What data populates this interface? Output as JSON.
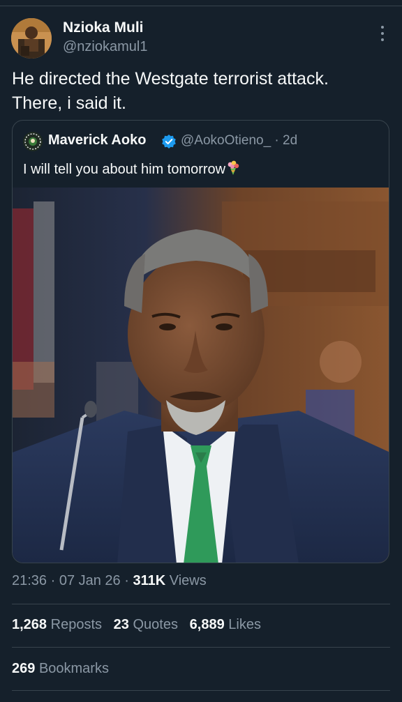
{
  "tweet": {
    "author": {
      "display_name": "Nzioka Muli",
      "handle": "@nziokamul1"
    },
    "text_line1": "He directed the Westgate terrorist attack.",
    "text_line2": "There, i said it.",
    "timestamp": "21:36 · 07 Jan 26 · ",
    "views_count": "311K",
    "views_label": "Views"
  },
  "quoted_tweet": {
    "display_name": "Maverick Aoko",
    "handle_time": "@AokoOtieno_ · 2d",
    "text": "I will tell you about him tomorrow",
    "emoji": "bouquet-emoji"
  },
  "engagement": {
    "reposts_count": "1,268",
    "reposts_label": "Reposts",
    "quotes_count": "23",
    "quotes_label": "Quotes",
    "likes_count": "6,889",
    "likes_label": "Likes",
    "bookmarks_count": "269",
    "bookmarks_label": "Bookmarks"
  },
  "colors": {
    "background": "#15202b",
    "text_primary": "#f7f9f9",
    "text_secondary": "#8b98a5",
    "divider": "#38444d",
    "verified": "#1d9bf0"
  },
  "icons": {
    "more": "more-vertical-icon",
    "verified": "verified-badge-icon"
  }
}
